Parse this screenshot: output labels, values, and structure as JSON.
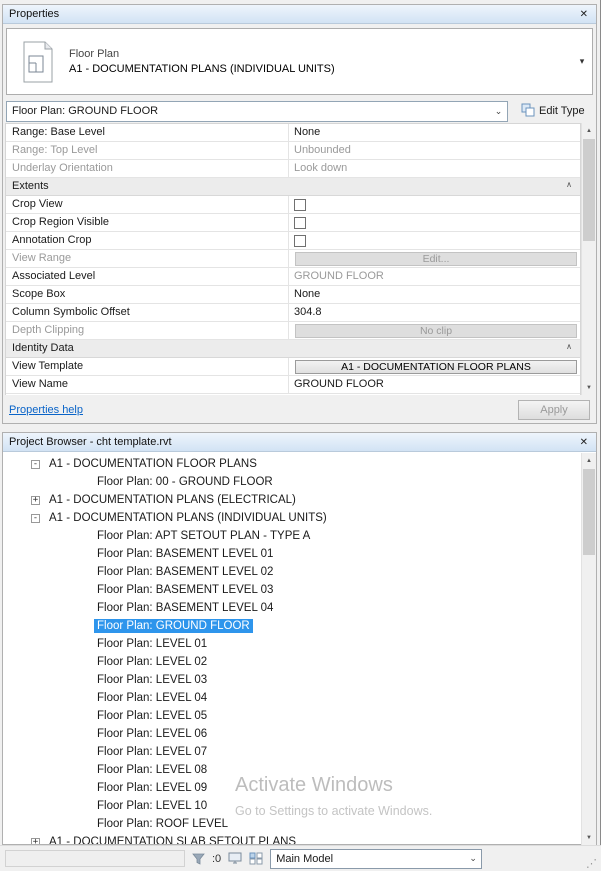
{
  "colors": {
    "selection": "#2e95ec",
    "titlebar_top": "#eef5fc",
    "titlebar_bottom": "#d2e3f4",
    "link": "#0a64c8"
  },
  "properties_panel": {
    "title": "Properties",
    "type_selector": {
      "family": "Floor Plan",
      "type": "A1 - DOCUMENTATION PLANS (INDIVIDUAL UNITS)"
    },
    "view_combo": "Floor Plan: GROUND FLOOR",
    "edit_type_label": "Edit Type",
    "rows": [
      {
        "label": "Range: Base Level",
        "value": "None",
        "kind": "text"
      },
      {
        "label": "Range: Top Level",
        "value": "Unbounded",
        "kind": "text",
        "label_dis": true,
        "value_dis": true
      },
      {
        "label": "Underlay Orientation",
        "value": "Look down",
        "kind": "text",
        "label_dis": true,
        "value_dis": true
      },
      {
        "label": "Extents",
        "kind": "section"
      },
      {
        "label": "Crop View",
        "kind": "checkbox"
      },
      {
        "label": "Crop Region Visible",
        "kind": "checkbox"
      },
      {
        "label": "Annotation Crop",
        "kind": "checkbox"
      },
      {
        "label": "View Range",
        "value": "Edit...",
        "kind": "button",
        "label_dis": true,
        "value_dis": true
      },
      {
        "label": "Associated Level",
        "value": "GROUND FLOOR",
        "kind": "text",
        "value_dis": true
      },
      {
        "label": "Scope Box",
        "value": "None",
        "kind": "text"
      },
      {
        "label": "Column Symbolic Offset",
        "value": "304.8",
        "kind": "text"
      },
      {
        "label": "Depth Clipping",
        "value": "No clip",
        "kind": "button",
        "label_dis": true,
        "value_dis": true
      },
      {
        "label": "Identity Data",
        "kind": "section"
      },
      {
        "label": "View Template",
        "value": "A1 - DOCUMENTATION FLOOR PLANS",
        "kind": "button"
      },
      {
        "label": "View Name",
        "value": "GROUND FLOOR",
        "kind": "text"
      }
    ],
    "help_link": "Properties help",
    "apply_label": "Apply"
  },
  "project_browser": {
    "title": "Project Browser - cht template.rvt",
    "tree": [
      {
        "label": "A1 - DOCUMENTATION FLOOR PLANS",
        "level": 0,
        "expander": "minus"
      },
      {
        "label": "Floor Plan: 00 - GROUND FLOOR",
        "level": 1
      },
      {
        "label": "A1 - DOCUMENTATION PLANS (ELECTRICAL)",
        "level": 0,
        "expander": "plus"
      },
      {
        "label": "A1 - DOCUMENTATION PLANS (INDIVIDUAL UNITS)",
        "level": 0,
        "expander": "minus"
      },
      {
        "label": "Floor Plan: APT SETOUT PLAN - TYPE A",
        "level": 1
      },
      {
        "label": "Floor Plan: BASEMENT LEVEL 01",
        "level": 1
      },
      {
        "label": "Floor Plan: BASEMENT LEVEL 02",
        "level": 1
      },
      {
        "label": "Floor Plan: BASEMENT LEVEL 03",
        "level": 1
      },
      {
        "label": "Floor Plan: BASEMENT LEVEL 04",
        "level": 1
      },
      {
        "label": "Floor Plan: GROUND FLOOR",
        "level": 1,
        "selected": true
      },
      {
        "label": "Floor Plan: LEVEL 01",
        "level": 1
      },
      {
        "label": "Floor Plan: LEVEL 02",
        "level": 1
      },
      {
        "label": "Floor Plan: LEVEL 03",
        "level": 1
      },
      {
        "label": "Floor Plan: LEVEL 04",
        "level": 1
      },
      {
        "label": "Floor Plan: LEVEL 05",
        "level": 1
      },
      {
        "label": "Floor Plan: LEVEL 06",
        "level": 1
      },
      {
        "label": "Floor Plan: LEVEL 07",
        "level": 1
      },
      {
        "label": "Floor Plan: LEVEL 08",
        "level": 1
      },
      {
        "label": "Floor Plan: LEVEL 09",
        "level": 1
      },
      {
        "label": "Floor Plan: LEVEL 10",
        "level": 1
      },
      {
        "label": "Floor Plan: ROOF LEVEL",
        "level": 1
      },
      {
        "label": "A1 - DOCUMENTATION SLAB SETOUT PLANS",
        "level": 0,
        "expander": "plus"
      }
    ]
  },
  "watermark": {
    "title": "Activate Windows",
    "subtitle": "Go to Settings to activate Windows."
  },
  "status_bar": {
    "selection_count": ":0",
    "design_option": "Main Model"
  }
}
